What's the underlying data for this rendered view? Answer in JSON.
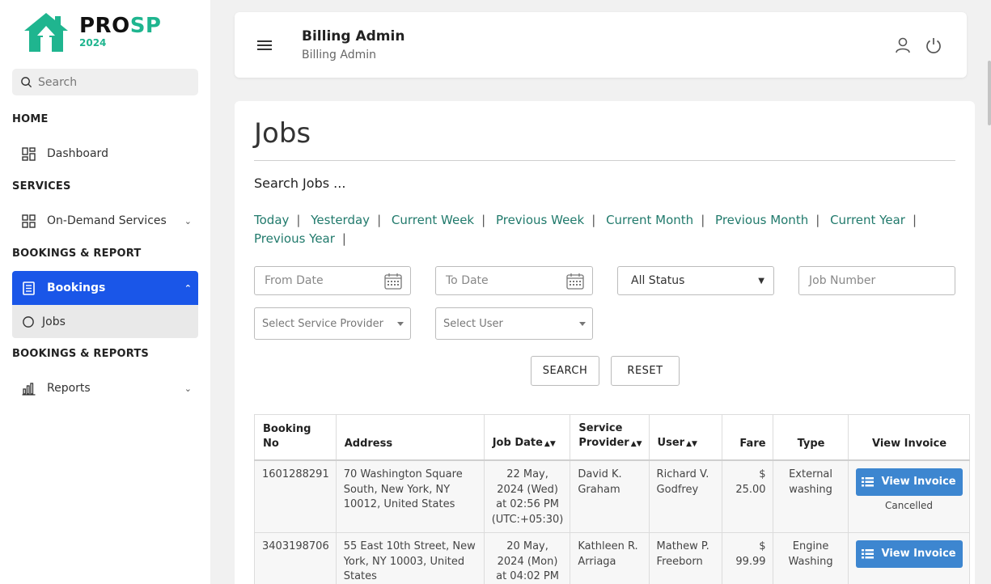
{
  "brand": {
    "name_part1": "PRO",
    "name_part2": "SP",
    "year": "2024",
    "primary": "#1fb58f"
  },
  "sidebar": {
    "search_placeholder": "Search",
    "sections": [
      "HOME",
      "SERVICES",
      "BOOKINGS & REPORT",
      "BOOKINGS & REPORTS"
    ],
    "items": [
      {
        "label": "Dashboard",
        "icon": "dashboard-icon"
      },
      {
        "label": "On-Demand Services",
        "icon": "grid-icon"
      },
      {
        "label": "Bookings",
        "icon": "document-icon",
        "active": true
      },
      {
        "label": "Jobs",
        "icon": "circle-icon"
      },
      {
        "label": "Reports",
        "icon": "bar-chart-icon"
      }
    ],
    "active_color": "#1a56e8"
  },
  "header": {
    "title": "Billing Admin",
    "subtitle": "Billing Admin"
  },
  "main": {
    "title": "Jobs",
    "search_label": "Search Jobs ...",
    "quick_links": [
      "Today",
      "Yesterday",
      "Current Week",
      "Previous Week",
      "Current Month",
      "Previous Month",
      "Current Year",
      "Previous Year"
    ],
    "filters": {
      "from_date_placeholder": "From Date",
      "to_date_placeholder": "To Date",
      "status_value": "All Status",
      "job_number_placeholder": "Job Number",
      "service_provider_placeholder": "Select Service Provider",
      "user_placeholder": "Select User"
    },
    "buttons": {
      "search": "SEARCH",
      "reset": "RESET"
    },
    "table": {
      "headers": {
        "booking_no": "Booking No",
        "address": "Address",
        "job_date": "Job Date",
        "service_provider_1": "Service",
        "service_provider_2": "Provider",
        "user": "User",
        "fare": "Fare",
        "type": "Type",
        "view_invoice": "View Invoice"
      },
      "rows": [
        {
          "booking_no": "1601288291",
          "address": "70 Washington Square South, New York, NY 10012, United States",
          "job_date": "22 May, 2024 (Wed) at 02:56 PM (UTC:+05:30)",
          "service_provider": "David K. Graham",
          "user": "Richard V. Godfrey",
          "fare": "$ 25.00",
          "type": "External washing",
          "invoice_label": "View Invoice",
          "status": "Cancelled"
        },
        {
          "booking_no": "3403198706",
          "address": "55 East 10th Street, New York, NY 10003, United States",
          "job_date": "20 May, 2024 (Mon) at 04:02 PM",
          "service_provider": "Kathleen R. Arriaga",
          "user": "Mathew P. Freeborn",
          "fare": "$ 99.99",
          "type": "Engine Washing",
          "invoice_label": "View Invoice",
          "status": ""
        }
      ]
    }
  }
}
